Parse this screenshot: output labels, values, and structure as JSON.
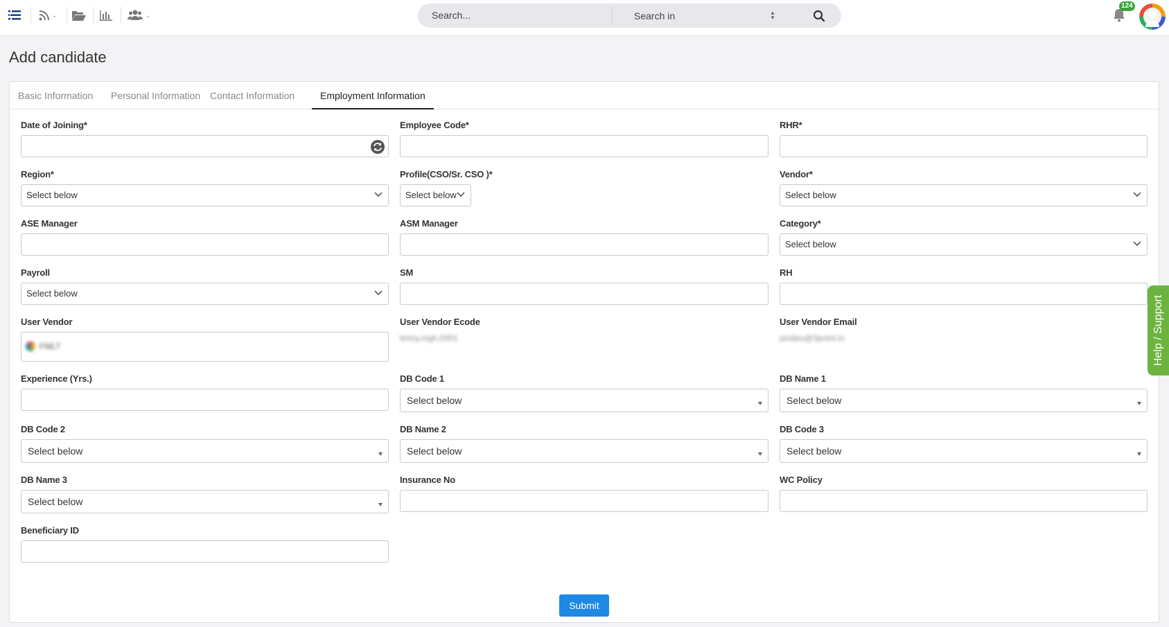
{
  "topbar": {
    "search_placeholder": "Search...",
    "search_in_label": "Search in",
    "notification_count": "124"
  },
  "page": {
    "title": "Add candidate"
  },
  "tabs": [
    {
      "label": "Basic Information"
    },
    {
      "label": "Personal Information"
    },
    {
      "label": "Contact Information"
    },
    {
      "label": "Employment Information",
      "active": true
    }
  ],
  "form": {
    "date_of_joining": {
      "label": "Date of Joining*"
    },
    "employee_code": {
      "label": "Employee Code*"
    },
    "rhr": {
      "label": "RHR*"
    },
    "region": {
      "label": "Region*",
      "value": "Select below"
    },
    "profile": {
      "label": "Profile(CSO/Sr. CSO )*",
      "value": "Select below"
    },
    "vendor": {
      "label": "Vendor*",
      "value": "Select below"
    },
    "ase_manager": {
      "label": "ASE Manager"
    },
    "asm_manager": {
      "label": "ASM Manager"
    },
    "category": {
      "label": "Category*",
      "value": "Select below"
    },
    "payroll": {
      "label": "Payroll",
      "value": "Select below"
    },
    "sm": {
      "label": "SM"
    },
    "rh": {
      "label": "RH"
    },
    "user_vendor": {
      "label": "User Vendor",
      "value": "FMLT"
    },
    "user_vendor_ecode": {
      "label": "User Vendor Ecode",
      "value": "lenny.ingh.0301"
    },
    "user_vendor_email": {
      "label": "User Vendor Email",
      "value": "pindeu@3point.in"
    },
    "experience": {
      "label": "Experience (Yrs.)"
    },
    "db_code_1": {
      "label": "DB Code 1",
      "value": "Select below"
    },
    "db_name_1": {
      "label": "DB Name 1",
      "value": "Select below"
    },
    "db_code_2": {
      "label": "DB Code 2",
      "value": "Select below"
    },
    "db_name_2": {
      "label": "DB Name 2",
      "value": "Select below"
    },
    "db_code_3": {
      "label": "DB Code 3",
      "value": "Select below"
    },
    "db_name_3": {
      "label": "DB Name 3",
      "value": "Select below"
    },
    "insurance_no": {
      "label": "Insurance No"
    },
    "wc_policy": {
      "label": "WC Policy"
    },
    "beneficiary_id": {
      "label": "Beneficiary ID"
    },
    "submit_label": "Submit"
  },
  "help_label": "Help / Support",
  "colors": {
    "accent": "#1e88e5",
    "help": "#6cb33f",
    "badge": "#3aa53a"
  },
  "icons": [
    "menu-icon",
    "rss-icon",
    "folder-icon",
    "bar-chart-icon",
    "users-icon",
    "search-icon",
    "bell-icon",
    "refresh-icon",
    "chevron-down-icon"
  ]
}
